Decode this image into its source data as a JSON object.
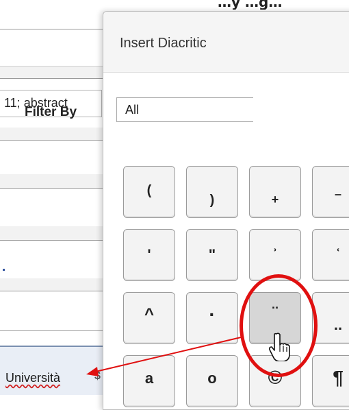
{
  "background_form": {
    "field_text": "11; abstract",
    "university_text": "Università"
  },
  "dialog": {
    "title": "Insert Diacritic",
    "filter_label": "Filter By",
    "filter_value": "All",
    "characters": [
      "(",
      ")",
      "+",
      "–",
      "ʹ",
      "ʺ",
      "ʾ",
      "ʿ",
      "^",
      "·",
      "¨",
      "..",
      "a",
      "o",
      "©",
      "¶"
    ]
  },
  "annotation": {
    "highlight_color": "#e01010",
    "highlighted_character": "¨"
  },
  "icons": {
    "cursor": "hand-pointer-icon",
    "dropdown": "dropdown-arrow-icon"
  }
}
